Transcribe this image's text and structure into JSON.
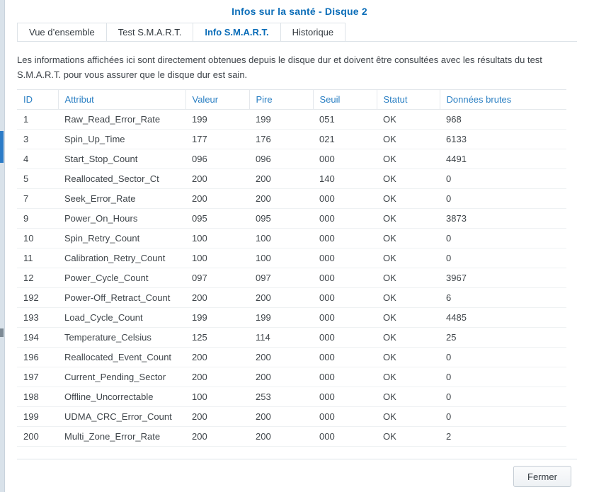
{
  "window": {
    "title": "Infos sur la santé - Disque 2"
  },
  "tabs": [
    {
      "label": "Vue d’ensemble",
      "active": false
    },
    {
      "label": "Test S.M.A.R.T.",
      "active": false
    },
    {
      "label": "Info S.M.A.R.T.",
      "active": true
    },
    {
      "label": "Historique",
      "active": false
    }
  ],
  "description": "Les informations affichées ici sont directement obtenues depuis le disque dur et doivent être consultées avec les résultats du test S.M.A.R.T. pour vous assurer que le disque dur est sain.",
  "table": {
    "headers": [
      "ID",
      "Attribut",
      "Valeur",
      "Pire",
      "Seuil",
      "Statut",
      "Données brutes"
    ],
    "rows": [
      [
        "1",
        "Raw_Read_Error_Rate",
        "199",
        "199",
        "051",
        "OK",
        "968"
      ],
      [
        "3",
        "Spin_Up_Time",
        "177",
        "176",
        "021",
        "OK",
        "6133"
      ],
      [
        "4",
        "Start_Stop_Count",
        "096",
        "096",
        "000",
        "OK",
        "4491"
      ],
      [
        "5",
        "Reallocated_Sector_Ct",
        "200",
        "200",
        "140",
        "OK",
        "0"
      ],
      [
        "7",
        "Seek_Error_Rate",
        "200",
        "200",
        "000",
        "OK",
        "0"
      ],
      [
        "9",
        "Power_On_Hours",
        "095",
        "095",
        "000",
        "OK",
        "3873"
      ],
      [
        "10",
        "Spin_Retry_Count",
        "100",
        "100",
        "000",
        "OK",
        "0"
      ],
      [
        "11",
        "Calibration_Retry_Count",
        "100",
        "100",
        "000",
        "OK",
        "0"
      ],
      [
        "12",
        "Power_Cycle_Count",
        "097",
        "097",
        "000",
        "OK",
        "3967"
      ],
      [
        "192",
        "Power-Off_Retract_Count",
        "200",
        "200",
        "000",
        "OK",
        "6"
      ],
      [
        "193",
        "Load_Cycle_Count",
        "199",
        "199",
        "000",
        "OK",
        "4485"
      ],
      [
        "194",
        "Temperature_Celsius",
        "125",
        "114",
        "000",
        "OK",
        "25"
      ],
      [
        "196",
        "Reallocated_Event_Count",
        "200",
        "200",
        "000",
        "OK",
        "0"
      ],
      [
        "197",
        "Current_Pending_Sector",
        "200",
        "200",
        "000",
        "OK",
        "0"
      ],
      [
        "198",
        "Offline_Uncorrectable",
        "100",
        "253",
        "000",
        "OK",
        "0"
      ],
      [
        "199",
        "UDMA_CRC_Error_Count",
        "200",
        "200",
        "000",
        "OK",
        "0"
      ],
      [
        "200",
        "Multi_Zone_Error_Rate",
        "200",
        "200",
        "000",
        "OK",
        "2"
      ]
    ]
  },
  "footer": {
    "close_label": "Fermer"
  },
  "colors": {
    "accent": "#0b6db8",
    "header_text": "#2a7fc3"
  }
}
